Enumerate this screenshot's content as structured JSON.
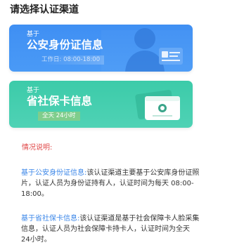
{
  "header": {
    "title": "请选择认证渠道"
  },
  "cards": [
    {
      "prefix": "基于",
      "title": "公安身份证信息",
      "hours": "工作日: 08:00-18:00"
    },
    {
      "prefix": "基于",
      "title": "省社保卡信息",
      "hours": "全天 24小时"
    }
  ],
  "info": {
    "label": "情况说明:",
    "items": [
      {
        "lead": "基于公安身份证信息:",
        "text": "该认证渠道主要基于公安库身份证照片，认证人员为身份证持有人，认证时间为每天 08:00-18:00。"
      },
      {
        "lead": "基于省社保卡信息:",
        "text": "该认证渠道是基于社会保障卡人脸采集信息，认证人员为社会保障卡持卡人，认证时间为全天 24小时。"
      }
    ]
  },
  "colors": {
    "id_card_bg": "#4495f4",
    "social_card_bg": "#45cfae",
    "highlight_blue": "#3a86e8",
    "label_red": "#e04848"
  },
  "icons": {
    "id_card_deco": "person-silhouette-id-card-icon",
    "social_card_deco": "social-security-card-icon"
  }
}
